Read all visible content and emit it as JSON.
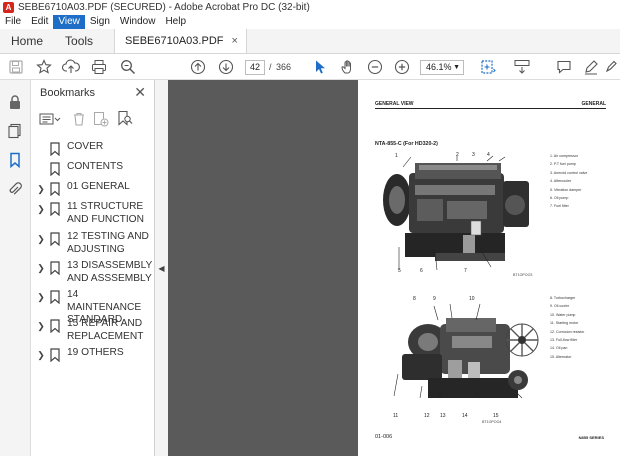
{
  "window": {
    "title": "SEBE6710A03.PDF (SECURED) - Adobe Acrobat Pro DC (32-bit)"
  },
  "menubar": {
    "items": [
      "File",
      "Edit",
      "View",
      "Sign",
      "Window",
      "Help"
    ],
    "active": "View"
  },
  "tabs": {
    "home": "Home",
    "tools": "Tools",
    "document": "SEBE6710A03.PDF",
    "close_glyph": "×"
  },
  "toolbar": {
    "current_page": "42",
    "separator": "/",
    "total_pages": "366",
    "zoom": "46.1%",
    "icons": [
      "save-icon",
      "star-icon",
      "upload-icon",
      "print-icon",
      "search-icon",
      "page-up-icon",
      "page-down-icon",
      "select-cursor-icon",
      "hand-icon",
      "zoom-out-icon",
      "zoom-in-icon",
      "fit-page-icon",
      "scroll-mode-icon",
      "comment-icon",
      "pen-icon",
      "sign-icon"
    ]
  },
  "left_rail": {
    "icons": [
      "lock-icon",
      "pages-icon",
      "bookmark-icon",
      "attachment-icon"
    ],
    "active": "bookmark-icon"
  },
  "bookmarks_panel": {
    "title": "Bookmarks",
    "close_glyph": "✕",
    "tool_icons": [
      "options-icon",
      "delete-icon",
      "new-bookmark-icon",
      "bookmark-search-icon"
    ],
    "items": [
      {
        "label": "COVER",
        "expandable": false
      },
      {
        "label": "CONTENTS",
        "expandable": false
      },
      {
        "label": "01 GENERAL",
        "expandable": true
      },
      {
        "label": "11 STRUCTURE AND FUNCTION",
        "expandable": true
      },
      {
        "label": "12 TESTING AND ADJUSTING",
        "expandable": true
      },
      {
        "label": "13 DISASSEMBLY AND ASSSEMBLY",
        "expandable": true
      },
      {
        "label": "14 MAINTENANCE STANDARD",
        "expandable": true
      },
      {
        "label": "15 REPAIR AND REPLACEMENT",
        "expandable": true
      },
      {
        "label": "19 OTHERS",
        "expandable": true
      }
    ]
  },
  "pdf_page": {
    "header_left": "GENERAL VIEW",
    "header_right": "GENERAL",
    "model": "NTA-855-C (For HD320-2)",
    "legend_top": [
      "1. Air compressor",
      "2. P.T fuel pump",
      "3. Aneroid control valve",
      "4. Aftercooler",
      "5. Vibration damper",
      "6. Oil pump",
      "7. Fuel filter"
    ],
    "legend_bottom": [
      "8. Turbocharger",
      "9. Oil cooler",
      "10. Water pump",
      "11. Starting motor",
      "12. Corrosion resistor",
      "13. Full-flow filter",
      "14. Oil pan",
      "15. Alternator"
    ],
    "photo_code_top": "BT1OPOO3",
    "photo_code_bottom": "BT1OPOO4",
    "callouts_top": [
      "1",
      "2",
      "3",
      "4",
      "5",
      "6",
      "7"
    ],
    "callouts_bottom": [
      "8",
      "9",
      "10",
      "11",
      "12",
      "13",
      "14",
      "15"
    ],
    "footer_left": "01-006",
    "footer_right": "N855 SERIES"
  },
  "colors": {
    "accent": "#1e6ec8",
    "app_icon": "#d4261c",
    "doc_background": "#5a5a5a"
  }
}
